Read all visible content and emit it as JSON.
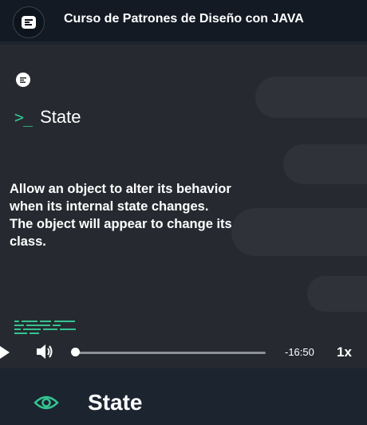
{
  "header": {
    "course_title": "Curso de Patrones de Diseño con JAVA",
    "logo_icon": "platform-logo-icon"
  },
  "video": {
    "section_title": "State",
    "prompt_icon": ">_",
    "quote": "Allow an object to alter its behavior when its internal state changes. The object will appear to change its class.",
    "accent_color": "#34c38f",
    "background_color": "#262a30"
  },
  "controls": {
    "play_icon": "play-icon",
    "volume_icon": "volume-icon",
    "progress_fraction": 0.0,
    "remaining_time": "-16:50",
    "speed": "1x"
  },
  "lesson": {
    "status_icon": "eye-icon",
    "title": "State",
    "icon_color": "#34c38f"
  }
}
